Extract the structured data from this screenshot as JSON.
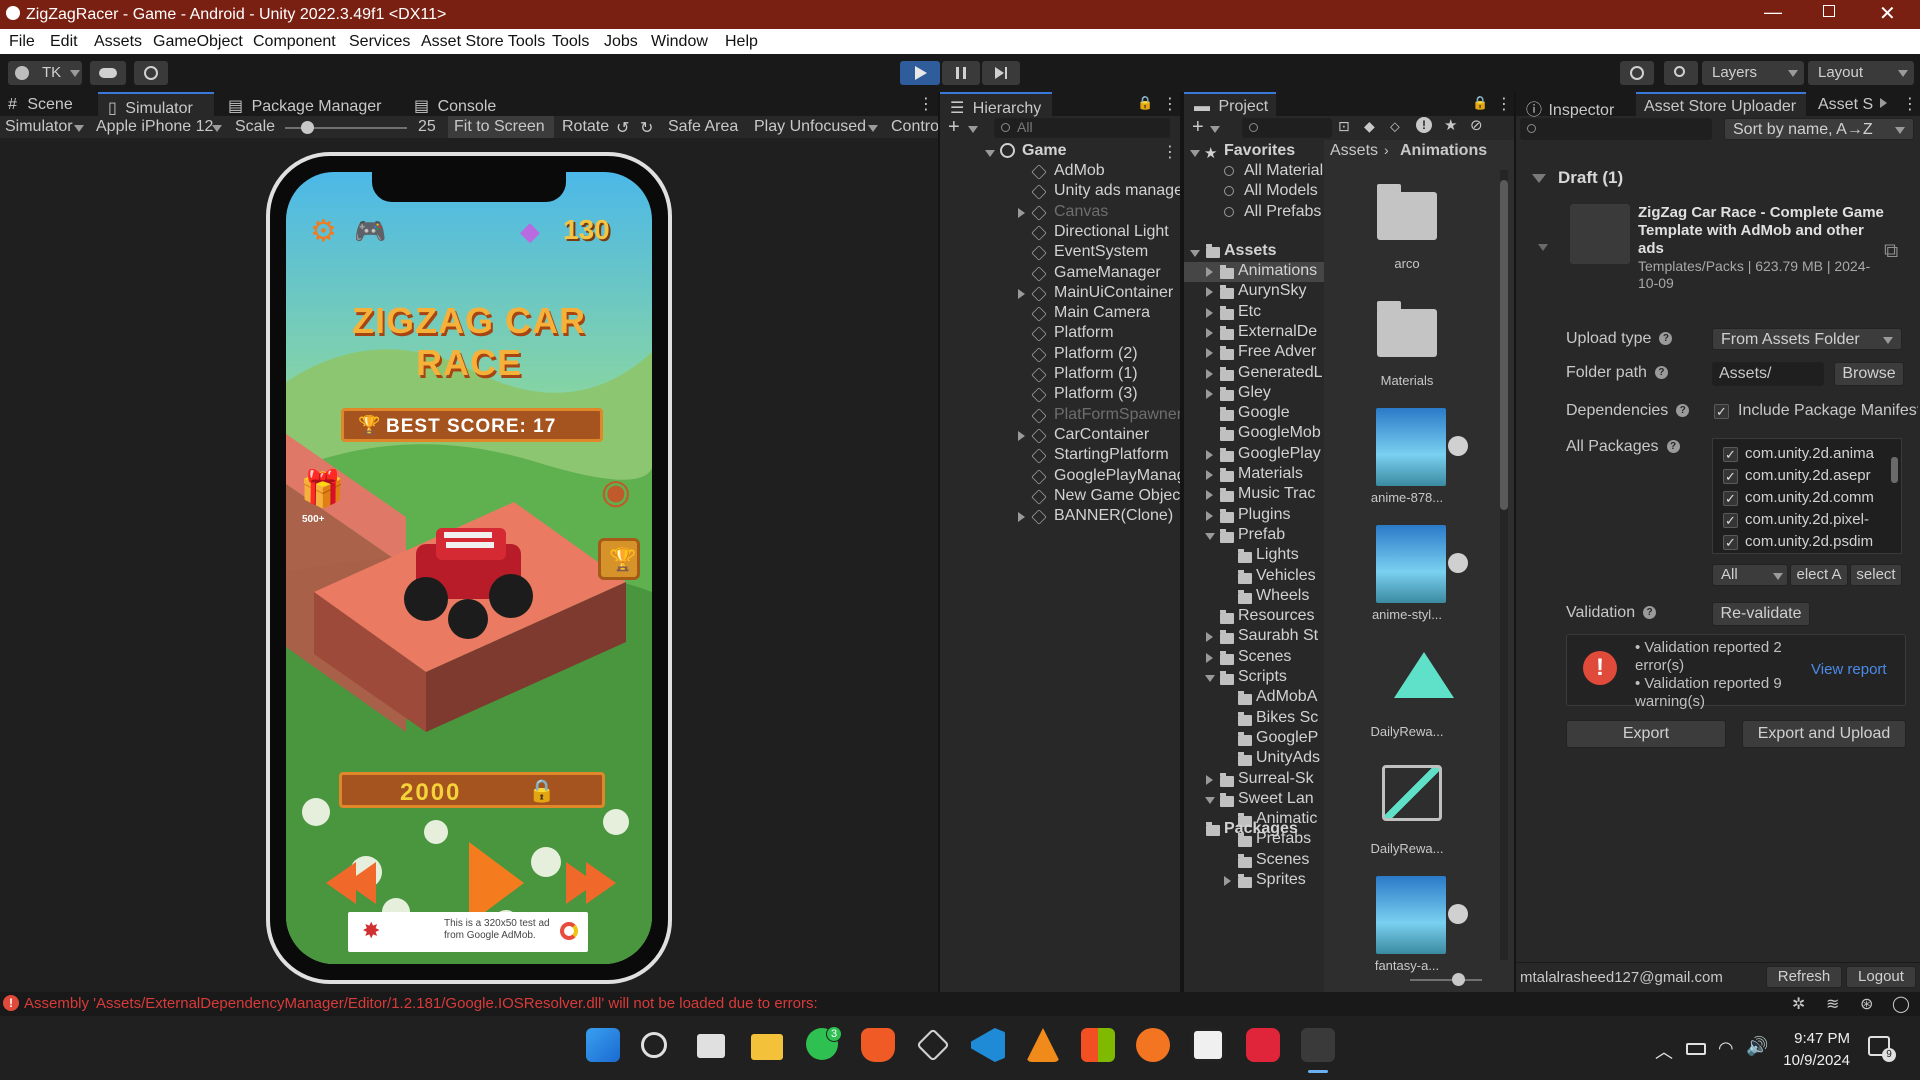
{
  "window": {
    "title": "ZigZagRacer - Game - Android - Unity 2022.3.49f1 <DX11>"
  },
  "menu": [
    "File",
    "Edit",
    "Assets",
    "GameObject",
    "Component",
    "Services",
    "Asset Store Tools",
    "Tools",
    "Jobs",
    "Window",
    "Help"
  ],
  "toolbar": {
    "account": "TK",
    "layers": "Layers",
    "layout": "Layout"
  },
  "sceneTabs": {
    "scene": "Scene",
    "simulator": "Simulator",
    "package_manager": "Package Manager",
    "console": "Console"
  },
  "simulatorBar": {
    "mode": "Simulator",
    "device": "Apple iPhone 12",
    "scale_label": "Scale",
    "scale_value": "25",
    "scale_fraction": 0.18,
    "fit": "Fit to Screen",
    "rotate": "Rotate",
    "safe_area": "Safe Area",
    "play_mode": "Play Unfocused",
    "control": "Contro"
  },
  "game": {
    "gems": "130",
    "title": "ZIGZAG CAR RACE",
    "best_score": "BEST SCORE: 17",
    "gift_label": "500+",
    "coins": "2000",
    "ad_text": "This is a 320x50 test ad from Google AdMob."
  },
  "hierarchy": {
    "tab": "Hierarchy",
    "search_placeholder": "All",
    "root": "Game",
    "items": [
      {
        "name": "AdMob",
        "arrow": false,
        "dim": false
      },
      {
        "name": "Unity ads manager",
        "arrow": false,
        "dim": false
      },
      {
        "name": "Canvas",
        "arrow": true,
        "dim": true
      },
      {
        "name": "Directional Light",
        "arrow": false,
        "dim": false
      },
      {
        "name": "EventSystem",
        "arrow": false,
        "dim": false
      },
      {
        "name": "GameManager",
        "arrow": false,
        "dim": false
      },
      {
        "name": "MainUiContainer",
        "arrow": true,
        "dim": false
      },
      {
        "name": "Main Camera",
        "arrow": false,
        "dim": false
      },
      {
        "name": "Platform",
        "arrow": false,
        "dim": false
      },
      {
        "name": "Platform (2)",
        "arrow": false,
        "dim": false
      },
      {
        "name": "Platform (1)",
        "arrow": false,
        "dim": false
      },
      {
        "name": "Platform (3)",
        "arrow": false,
        "dim": false
      },
      {
        "name": "PlatFormSpawner",
        "arrow": false,
        "dim": true
      },
      {
        "name": "CarContainer",
        "arrow": true,
        "dim": false
      },
      {
        "name": "StartingPlatform",
        "arrow": false,
        "dim": false
      },
      {
        "name": "GooglePlayManage",
        "arrow": false,
        "dim": false
      },
      {
        "name": "New Game Object",
        "arrow": false,
        "dim": false
      },
      {
        "name": "BANNER(Clone)",
        "arrow": true,
        "dim": false
      }
    ]
  },
  "project": {
    "tab": "Project",
    "favorites": "Favorites",
    "favorite_items": [
      "All Material",
      "All Models",
      "All Prefabs"
    ],
    "assets": "Assets",
    "tree": [
      {
        "name": "Animations",
        "indent": 1,
        "arrow": "right",
        "selected": true
      },
      {
        "name": "AurynSky",
        "indent": 1,
        "arrow": "right"
      },
      {
        "name": "Etc",
        "indent": 1,
        "arrow": "right"
      },
      {
        "name": "ExternalDe",
        "indent": 1,
        "arrow": "right"
      },
      {
        "name": "Free Adver",
        "indent": 1,
        "arrow": "right"
      },
      {
        "name": "GeneratedL",
        "indent": 1,
        "arrow": "right"
      },
      {
        "name": "Gley",
        "indent": 1,
        "arrow": "right"
      },
      {
        "name": "Google",
        "indent": 1,
        "arrow": "none"
      },
      {
        "name": "GoogleMob",
        "indent": 1,
        "arrow": "none"
      },
      {
        "name": "GooglePlay",
        "indent": 1,
        "arrow": "right"
      },
      {
        "name": "Materials",
        "indent": 1,
        "arrow": "right"
      },
      {
        "name": "Music Trac",
        "indent": 1,
        "arrow": "right"
      },
      {
        "name": "Plugins",
        "indent": 1,
        "arrow": "right"
      },
      {
        "name": "Prefab",
        "indent": 1,
        "arrow": "down"
      },
      {
        "name": "Lights",
        "indent": 2,
        "arrow": "none"
      },
      {
        "name": "Vehicles",
        "indent": 2,
        "arrow": "none"
      },
      {
        "name": "Wheels",
        "indent": 2,
        "arrow": "none"
      },
      {
        "name": "Resources",
        "indent": 1,
        "arrow": "none"
      },
      {
        "name": "Saurabh St",
        "indent": 1,
        "arrow": "right"
      },
      {
        "name": "Scenes",
        "indent": 1,
        "arrow": "right"
      },
      {
        "name": "Scripts",
        "indent": 1,
        "arrow": "down"
      },
      {
        "name": "AdMobA",
        "indent": 2,
        "arrow": "none"
      },
      {
        "name": "Bikes Sc",
        "indent": 2,
        "arrow": "none"
      },
      {
        "name": "GoogleP",
        "indent": 2,
        "arrow": "none"
      },
      {
        "name": "UnityAds",
        "indent": 2,
        "arrow": "none"
      },
      {
        "name": "Surreal-Sk",
        "indent": 1,
        "arrow": "right"
      },
      {
        "name": "Sweet Lan",
        "indent": 1,
        "arrow": "down"
      },
      {
        "name": "Animatic",
        "indent": 2,
        "arrow": "none"
      },
      {
        "name": "Prefabs",
        "indent": 2,
        "arrow": "none"
      },
      {
        "name": "Scenes",
        "indent": 2,
        "arrow": "none"
      },
      {
        "name": "Sprites",
        "indent": 2,
        "arrow": "right"
      }
    ],
    "packages": "Packages",
    "breadcrumb": [
      "Assets",
      "Animations"
    ],
    "grid_items": [
      {
        "name": "arco",
        "kind": "folder"
      },
      {
        "name": "Materials",
        "kind": "folder"
      },
      {
        "name": "anime-878...",
        "kind": "image"
      },
      {
        "name": "anime-styl...",
        "kind": "image"
      },
      {
        "name": "DailyRewa...",
        "kind": "anim"
      },
      {
        "name": "DailyRewa...",
        "kind": "controller"
      },
      {
        "name": "fantasy-a...",
        "kind": "image"
      }
    ]
  },
  "inspector": {
    "tabs": [
      "Inspector",
      "Asset Store Uploader",
      "Asset S"
    ],
    "sort": "Sort by name, A→Z",
    "draft_header": "Draft (1)",
    "package_title": "ZigZag Car Race - Complete Game Template with AdMob and other ads",
    "package_meta": "Templates/Packs | 623.79 MB | 2024-10-09",
    "upload_type_label": "Upload type",
    "upload_type_value": "From Assets Folder",
    "folder_path_label": "Folder path",
    "folder_path_value": "Assets/",
    "browse": "Browse",
    "dependencies_label": "Dependencies",
    "include_manifest": "Include Package Manifest",
    "all_packages_label": "All Packages",
    "packages": [
      "com.unity.2d.anima",
      "com.unity.2d.asepr",
      "com.unity.2d.comm",
      "com.unity.2d.pixel-",
      "com.unity.2d.psdim"
    ],
    "filter_all": "All",
    "select_all": "elect A",
    "deselect": "select",
    "validation_label": "Validation",
    "revalidate": "Re-validate",
    "validation_errors": "• Validation reported 2 error(s)",
    "validation_warnings": "• Validation reported 9 warning(s)",
    "view_report": "View report",
    "export": "Export",
    "export_upload": "Export and Upload",
    "account_email": "mtalalrasheed127@gmail.com",
    "refresh": "Refresh",
    "logout": "Logout"
  },
  "status": {
    "error": "Assembly 'Assets/ExternalDependencyManager/Editor/1.2.181/Google.IOSResolver.dll' will not be loaded due to errors:"
  },
  "taskbar": {
    "time": "9:47 PM",
    "date": "10/9/2024",
    "whatsapp_badge": "3",
    "notif_badge": "9"
  },
  "colors": {
    "title_bar": "#7a2012",
    "accent": "#3a79d9",
    "error": "#d93a3a"
  }
}
